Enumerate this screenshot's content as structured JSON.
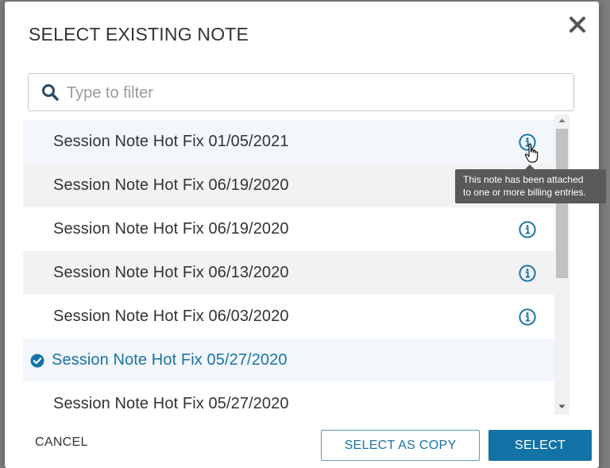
{
  "dialog": {
    "title": "SELECT EXISTING NOTE",
    "close_icon": "close-icon"
  },
  "filter": {
    "placeholder": "Type to filter",
    "value": "",
    "icon": "search-icon"
  },
  "notes": [
    {
      "label": "Session Note Hot Fix 01/05/2021",
      "attached": true,
      "selected": false,
      "hovered": true
    },
    {
      "label": "Session Note Hot Fix 06/19/2020",
      "attached": false,
      "selected": false,
      "hovered": false
    },
    {
      "label": "Session Note Hot Fix 06/19/2020",
      "attached": true,
      "selected": false,
      "hovered": false
    },
    {
      "label": "Session Note Hot Fix 06/13/2020",
      "attached": true,
      "selected": false,
      "hovered": false
    },
    {
      "label": "Session Note Hot Fix 06/03/2020",
      "attached": true,
      "selected": false,
      "hovered": false
    },
    {
      "label": "Session Note Hot Fix 05/27/2020",
      "attached": false,
      "selected": true,
      "hovered": false
    },
    {
      "label": "Session Note Hot Fix 05/27/2020",
      "attached": false,
      "selected": false,
      "hovered": false
    }
  ],
  "tooltip": {
    "line1": "This note has been attached",
    "line2": "to one or more billing entries."
  },
  "footer": {
    "cancel_label": "CANCEL",
    "copy_label": "SELECT AS COPY",
    "select_label": "SELECT"
  },
  "colors": {
    "accent": "#1473a6",
    "selected_text": "#1a73a6",
    "info_icon": "#1a73a6",
    "tooltip_bg": "#595959"
  }
}
